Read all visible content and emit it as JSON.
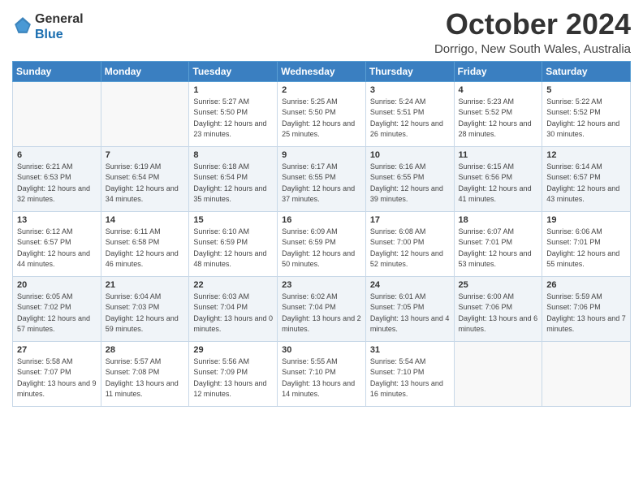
{
  "app": {
    "name_line1": "General",
    "name_line2": "Blue"
  },
  "header": {
    "month_year": "October 2024",
    "location": "Dorrigo, New South Wales, Australia"
  },
  "weekdays": [
    "Sunday",
    "Monday",
    "Tuesday",
    "Wednesday",
    "Thursday",
    "Friday",
    "Saturday"
  ],
  "weeks": [
    [
      {
        "day": "",
        "sunrise": "",
        "sunset": "",
        "daylight": ""
      },
      {
        "day": "",
        "sunrise": "",
        "sunset": "",
        "daylight": ""
      },
      {
        "day": "1",
        "sunrise": "Sunrise: 5:27 AM",
        "sunset": "Sunset: 5:50 PM",
        "daylight": "Daylight: 12 hours and 23 minutes."
      },
      {
        "day": "2",
        "sunrise": "Sunrise: 5:25 AM",
        "sunset": "Sunset: 5:50 PM",
        "daylight": "Daylight: 12 hours and 25 minutes."
      },
      {
        "day": "3",
        "sunrise": "Sunrise: 5:24 AM",
        "sunset": "Sunset: 5:51 PM",
        "daylight": "Daylight: 12 hours and 26 minutes."
      },
      {
        "day": "4",
        "sunrise": "Sunrise: 5:23 AM",
        "sunset": "Sunset: 5:52 PM",
        "daylight": "Daylight: 12 hours and 28 minutes."
      },
      {
        "day": "5",
        "sunrise": "Sunrise: 5:22 AM",
        "sunset": "Sunset: 5:52 PM",
        "daylight": "Daylight: 12 hours and 30 minutes."
      }
    ],
    [
      {
        "day": "6",
        "sunrise": "Sunrise: 6:21 AM",
        "sunset": "Sunset: 6:53 PM",
        "daylight": "Daylight: 12 hours and 32 minutes."
      },
      {
        "day": "7",
        "sunrise": "Sunrise: 6:19 AM",
        "sunset": "Sunset: 6:54 PM",
        "daylight": "Daylight: 12 hours and 34 minutes."
      },
      {
        "day": "8",
        "sunrise": "Sunrise: 6:18 AM",
        "sunset": "Sunset: 6:54 PM",
        "daylight": "Daylight: 12 hours and 35 minutes."
      },
      {
        "day": "9",
        "sunrise": "Sunrise: 6:17 AM",
        "sunset": "Sunset: 6:55 PM",
        "daylight": "Daylight: 12 hours and 37 minutes."
      },
      {
        "day": "10",
        "sunrise": "Sunrise: 6:16 AM",
        "sunset": "Sunset: 6:55 PM",
        "daylight": "Daylight: 12 hours and 39 minutes."
      },
      {
        "day": "11",
        "sunrise": "Sunrise: 6:15 AM",
        "sunset": "Sunset: 6:56 PM",
        "daylight": "Daylight: 12 hours and 41 minutes."
      },
      {
        "day": "12",
        "sunrise": "Sunrise: 6:14 AM",
        "sunset": "Sunset: 6:57 PM",
        "daylight": "Daylight: 12 hours and 43 minutes."
      }
    ],
    [
      {
        "day": "13",
        "sunrise": "Sunrise: 6:12 AM",
        "sunset": "Sunset: 6:57 PM",
        "daylight": "Daylight: 12 hours and 44 minutes."
      },
      {
        "day": "14",
        "sunrise": "Sunrise: 6:11 AM",
        "sunset": "Sunset: 6:58 PM",
        "daylight": "Daylight: 12 hours and 46 minutes."
      },
      {
        "day": "15",
        "sunrise": "Sunrise: 6:10 AM",
        "sunset": "Sunset: 6:59 PM",
        "daylight": "Daylight: 12 hours and 48 minutes."
      },
      {
        "day": "16",
        "sunrise": "Sunrise: 6:09 AM",
        "sunset": "Sunset: 6:59 PM",
        "daylight": "Daylight: 12 hours and 50 minutes."
      },
      {
        "day": "17",
        "sunrise": "Sunrise: 6:08 AM",
        "sunset": "Sunset: 7:00 PM",
        "daylight": "Daylight: 12 hours and 52 minutes."
      },
      {
        "day": "18",
        "sunrise": "Sunrise: 6:07 AM",
        "sunset": "Sunset: 7:01 PM",
        "daylight": "Daylight: 12 hours and 53 minutes."
      },
      {
        "day": "19",
        "sunrise": "Sunrise: 6:06 AM",
        "sunset": "Sunset: 7:01 PM",
        "daylight": "Daylight: 12 hours and 55 minutes."
      }
    ],
    [
      {
        "day": "20",
        "sunrise": "Sunrise: 6:05 AM",
        "sunset": "Sunset: 7:02 PM",
        "daylight": "Daylight: 12 hours and 57 minutes."
      },
      {
        "day": "21",
        "sunrise": "Sunrise: 6:04 AM",
        "sunset": "Sunset: 7:03 PM",
        "daylight": "Daylight: 12 hours and 59 minutes."
      },
      {
        "day": "22",
        "sunrise": "Sunrise: 6:03 AM",
        "sunset": "Sunset: 7:04 PM",
        "daylight": "Daylight: 13 hours and 0 minutes."
      },
      {
        "day": "23",
        "sunrise": "Sunrise: 6:02 AM",
        "sunset": "Sunset: 7:04 PM",
        "daylight": "Daylight: 13 hours and 2 minutes."
      },
      {
        "day": "24",
        "sunrise": "Sunrise: 6:01 AM",
        "sunset": "Sunset: 7:05 PM",
        "daylight": "Daylight: 13 hours and 4 minutes."
      },
      {
        "day": "25",
        "sunrise": "Sunrise: 6:00 AM",
        "sunset": "Sunset: 7:06 PM",
        "daylight": "Daylight: 13 hours and 6 minutes."
      },
      {
        "day": "26",
        "sunrise": "Sunrise: 5:59 AM",
        "sunset": "Sunset: 7:06 PM",
        "daylight": "Daylight: 13 hours and 7 minutes."
      }
    ],
    [
      {
        "day": "27",
        "sunrise": "Sunrise: 5:58 AM",
        "sunset": "Sunset: 7:07 PM",
        "daylight": "Daylight: 13 hours and 9 minutes."
      },
      {
        "day": "28",
        "sunrise": "Sunrise: 5:57 AM",
        "sunset": "Sunset: 7:08 PM",
        "daylight": "Daylight: 13 hours and 11 minutes."
      },
      {
        "day": "29",
        "sunrise": "Sunrise: 5:56 AM",
        "sunset": "Sunset: 7:09 PM",
        "daylight": "Daylight: 13 hours and 12 minutes."
      },
      {
        "day": "30",
        "sunrise": "Sunrise: 5:55 AM",
        "sunset": "Sunset: 7:10 PM",
        "daylight": "Daylight: 13 hours and 14 minutes."
      },
      {
        "day": "31",
        "sunrise": "Sunrise: 5:54 AM",
        "sunset": "Sunset: 7:10 PM",
        "daylight": "Daylight: 13 hours and 16 minutes."
      },
      {
        "day": "",
        "sunrise": "",
        "sunset": "",
        "daylight": ""
      },
      {
        "day": "",
        "sunrise": "",
        "sunset": "",
        "daylight": ""
      }
    ]
  ]
}
